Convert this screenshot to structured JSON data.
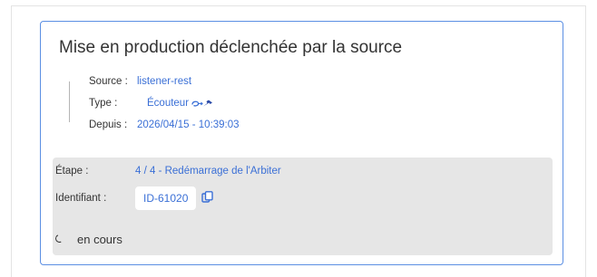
{
  "card": {
    "title": "Mise en production déclenchée par la source",
    "source_label": "Source :",
    "source_value": "listener-rest",
    "type_label": "Type :",
    "type_value": "Écouteur",
    "type_icons": [
      "ear-icon",
      "pin-icon"
    ],
    "since_label": "Depuis :",
    "since_value": "2026/04/15 - 10:39:03"
  },
  "status": {
    "step_label": "Étape :",
    "step_value": "4 / 4 - Redémarrage de l'Arbiter",
    "id_label": "Identifiant :",
    "id_value": "ID-61020",
    "progress_text": "en cours"
  },
  "colors": {
    "accent": "#3a6fd6",
    "card_border": "#5b8fe3",
    "panel_bg": "#e6e6e6",
    "text": "#333333"
  }
}
